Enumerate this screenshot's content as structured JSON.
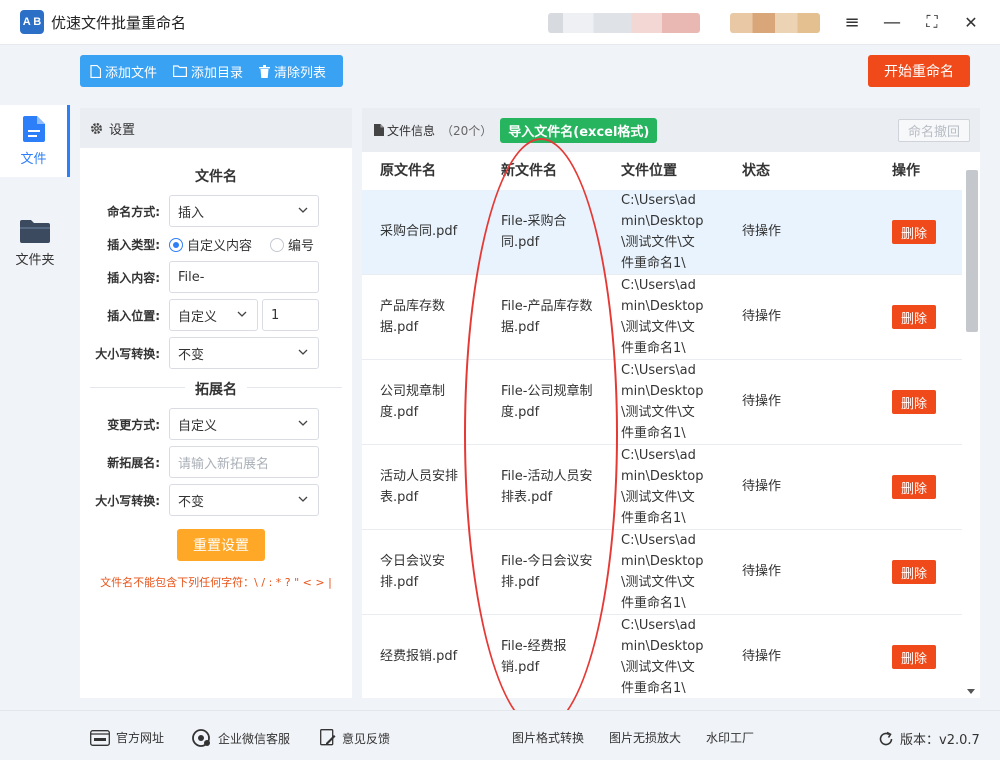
{
  "app": {
    "title": "优速文件批量重命名",
    "logo_text": "A B"
  },
  "window_controls": {
    "menu": "≡",
    "minimize": "—",
    "maximize": "⛶",
    "close": "✕"
  },
  "nav": [
    {
      "label": "文件",
      "icon": "file-icon",
      "active": true
    },
    {
      "label": "文件夹",
      "icon": "folder-icon",
      "active": false
    }
  ],
  "toolbar": {
    "add_file": "添加文件",
    "add_dir": "添加目录",
    "clear_list": "清除列表",
    "start": "开始重命名"
  },
  "settings": {
    "header": "设置",
    "filename_section": "文件名",
    "naming_mode_label": "命名方式:",
    "naming_mode_value": "插入",
    "insert_type_label": "插入类型:",
    "insert_type_option1": "自定义内容",
    "insert_type_option2": "编号",
    "insert_content_label": "插入内容:",
    "insert_content_value": "File-",
    "insert_pos_label": "插入位置:",
    "insert_pos_value": "自定义",
    "insert_pos_number": "1",
    "case_label": "大小写转换:",
    "case_value": "不变",
    "ext_section": "拓展名",
    "change_mode_label": "变更方式:",
    "change_mode_value": "自定义",
    "new_ext_label": "新拓展名:",
    "new_ext_placeholder": "请输入新拓展名",
    "ext_case_label": "大小写转换:",
    "ext_case_value": "不变",
    "reset": "重置设置",
    "warning": "文件名不能包含下列任何字符：\\ / : * ? \" < > |"
  },
  "files": {
    "info_label": "文件信息",
    "count": "（20个）",
    "import_btn": "导入文件名(excel格式)",
    "undo_btn": "命名撤回",
    "columns": {
      "orig": "原文件名",
      "new": "新文件名",
      "loc": "文件位置",
      "status": "状态",
      "op": "操作"
    },
    "rows": [
      {
        "orig": "采购合同.pdf",
        "new": "File-采购合同.pdf",
        "loc": "C:\\Users\\admin\\Desktop\\测试文件\\文件重命名1\\",
        "status": "待操作",
        "op": "删除"
      },
      {
        "orig": "产品库存数据.pdf",
        "new": "File-产品库存数据.pdf",
        "loc": "C:\\Users\\admin\\Desktop\\测试文件\\文件重命名1\\",
        "status": "待操作",
        "op": "删除"
      },
      {
        "orig": "公司规章制度.pdf",
        "new": "File-公司规章制度.pdf",
        "loc": "C:\\Users\\admin\\Desktop\\测试文件\\文件重命名1\\",
        "status": "待操作",
        "op": "删除"
      },
      {
        "orig": "活动人员安排表.pdf",
        "new": "File-活动人员安排表.pdf",
        "loc": "C:\\Users\\admin\\Desktop\\测试文件\\文件重命名1\\",
        "status": "待操作",
        "op": "删除"
      },
      {
        "orig": "今日会议安排.pdf",
        "new": "File-今日会议安排.pdf",
        "loc": "C:\\Users\\admin\\Desktop\\测试文件\\文件重命名1\\",
        "status": "待操作",
        "op": "删除"
      },
      {
        "orig": "经费报销.pdf",
        "new": "File-经费报销.pdf",
        "loc": "C:\\Users\\admin\\Desktop\\测试文件\\文件重命名1\\",
        "status": "待操作",
        "op": "删除"
      }
    ]
  },
  "footer": {
    "website": "官方网址",
    "wechat": "企业微信客服",
    "feedback": "意见反馈",
    "img_convert": "图片格式转换",
    "img_enlarge": "图片无损放大",
    "watermark": "水印工厂",
    "version": "版本：v2.0.7"
  },
  "colors": {
    "primary": "#2d7ff9",
    "toolbar": "#3aa2f2",
    "danger": "#f04a1a",
    "success": "#27b45f",
    "warning": "#ffa726",
    "annotation": "#e53935"
  }
}
